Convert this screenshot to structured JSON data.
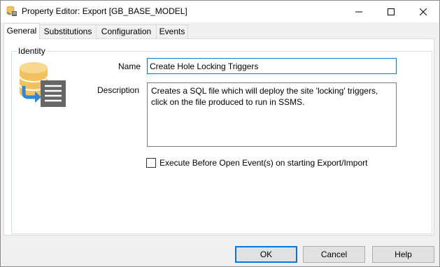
{
  "window": {
    "title": "Property Editor: Export [GB_BASE_MODEL]",
    "icon": "database-export-icon"
  },
  "tabs": [
    {
      "label": "General",
      "active": true
    },
    {
      "label": "Substitutions",
      "active": false
    },
    {
      "label": "Configuration",
      "active": false
    },
    {
      "label": "Events",
      "active": false
    }
  ],
  "identity": {
    "group_label": "Identity",
    "name_label": "Name",
    "name_value": "Create Hole Locking Triggers",
    "description_label": "Description",
    "description_value": "Creates a SQL file which will deploy the site 'locking' triggers, click on the file produced to run in SSMS.",
    "checkbox_label": "Execute Before Open Event(s) on starting Export/Import",
    "checkbox_checked": false
  },
  "buttons": {
    "ok": "OK",
    "cancel": "Cancel",
    "help": "Help"
  },
  "colors": {
    "accent": "#0078d7",
    "db_gold": "#f2c161",
    "arrow_blue": "#2e86d4",
    "doc_gray": "#666666"
  }
}
